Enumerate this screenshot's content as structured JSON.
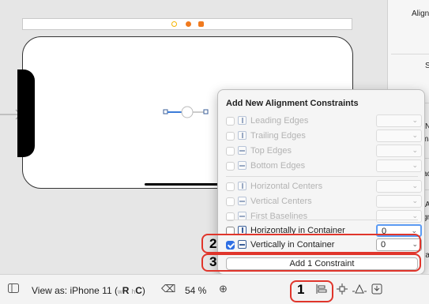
{
  "inspector": {
    "lines": [
      {
        "text": "Alignm"
      },
      {
        "text": "S"
      },
      {
        "text": "N"
      },
      {
        "text": "ma"
      },
      {
        "text": "ac"
      },
      {
        "text": "A"
      },
      {
        "text": "gn"
      },
      {
        "text": "ra"
      }
    ]
  },
  "popover": {
    "title": "Add New Alignment Constraints",
    "rows": [
      {
        "label": "Leading Edges",
        "value": "",
        "checked": false,
        "enabled": false
      },
      {
        "label": "Trailing Edges",
        "value": "",
        "checked": false,
        "enabled": false
      },
      {
        "label": "Top Edges",
        "value": "",
        "checked": false,
        "enabled": false
      },
      {
        "label": "Bottom Edges",
        "value": "",
        "checked": false,
        "enabled": false
      },
      {
        "label": "Horizontal Centers",
        "value": "",
        "checked": false,
        "enabled": false
      },
      {
        "label": "Vertical Centers",
        "value": "",
        "checked": false,
        "enabled": false
      },
      {
        "label": "First Baselines",
        "value": "",
        "checked": false,
        "enabled": false
      },
      {
        "label": "Horizontally in Container",
        "value": "0",
        "checked": false,
        "enabled": true
      },
      {
        "label": "Vertically in Container",
        "value": "0",
        "checked": true,
        "enabled": true
      }
    ],
    "add_button": "Add 1 Constraint"
  },
  "callouts": {
    "one": "1",
    "two": "2",
    "three": "3"
  },
  "bottombar": {
    "view_as_prefix": "View as: iPhone 11 (",
    "w": "w",
    "r": "R",
    "h": "h",
    "c": "C",
    "close": ")",
    "zoom": "54 %"
  },
  "icons": {
    "sidebar": "sidebar-toggle-icon",
    "zoom_out": "zoom-out-icon",
    "zoom_in": "zoom-in-icon",
    "align": "align-icon",
    "add_constraints": "add-new-constraints-icon",
    "resolve": "resolve-auto-layout-icon",
    "embed": "embed-in-icon"
  },
  "colors": {
    "accent": "#2f6fe4",
    "highlight": "#e0352b",
    "dock_yellow": "#f5b400",
    "dock_orange": "#f07a1e"
  }
}
